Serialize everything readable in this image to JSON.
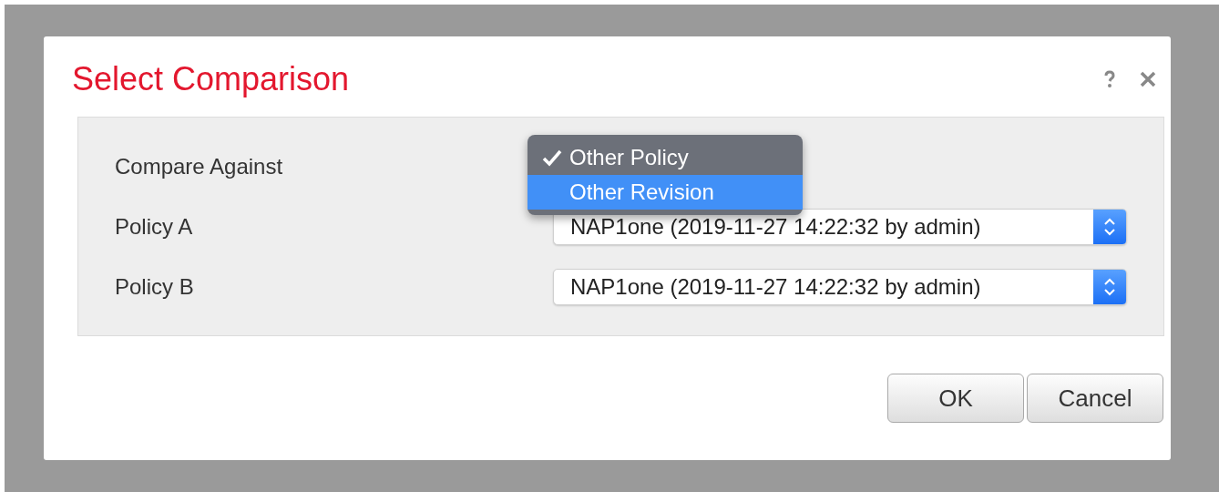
{
  "dialog": {
    "title": "Select Comparison"
  },
  "fields": [
    {
      "label": "Compare Against",
      "kind": "menu",
      "menu": [
        {
          "label": "Other Policy",
          "checked": true,
          "selected": false
        },
        {
          "label": "Other Revision",
          "checked": false,
          "selected": true
        }
      ]
    },
    {
      "label": "Policy A",
      "kind": "select",
      "value": "NAP1one (2019-11-27 14:22:32 by admin)"
    },
    {
      "label": "Policy B",
      "kind": "select",
      "value": "NAP1one (2019-11-27 14:22:32 by admin)"
    }
  ],
  "buttons": [
    "OK",
    "Cancel"
  ]
}
